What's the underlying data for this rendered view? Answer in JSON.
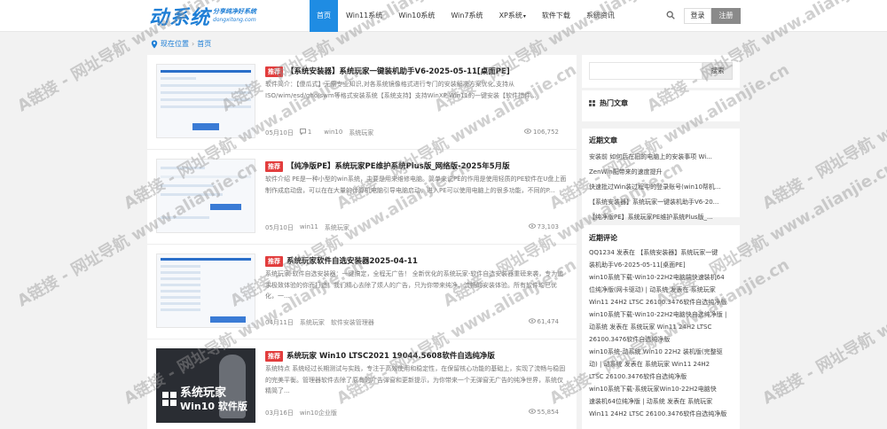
{
  "header": {
    "logo_main": "动系统",
    "logo_sub_cn": "分享纯净好系统",
    "logo_sub_en": "dongxitong.com",
    "nav": [
      "首页",
      "Win11系统",
      "Win10系统",
      "Win7系统",
      "XP系统",
      "软件下载",
      "系统资讯"
    ],
    "xp_caret": "▾",
    "login": "登录",
    "register": "注册"
  },
  "breadcrumb": {
    "label": "现在位置",
    "sep": "›",
    "home": "首页"
  },
  "posts": [
    {
      "tag": "推荐",
      "title": "【系统安装器】系统玩家一键装机助手V6-2025-05-11[桌面PE]",
      "desc": "软件简介：【傻瓜式】无需专业知识,对各系统镜像格式进行专门的安装解决方案优化,支持从ISO/wim/esd/gho/swm等格式安装系统【系统支持】支持WinXP-Win11的一键安装【软件措件...",
      "date": "05月10日",
      "comments": "1",
      "cats": [
        "win10",
        "系统玩家"
      ],
      "views": "106,752"
    },
    {
      "tag": "推荐",
      "title": "【纯净版PE】系统玩家PE维护系统Plus版_网络版-2025年5月版",
      "desc": "软件介绍 PE是一种小型的win系统，主要是用来维修电脑。简单来说PE的作用是使用轻质的PE软件在U盘上面制作成启动盘，可以在在大量的计算机电脑引导电脑启动，进入PE可以使用电脑上的很多功能，不同的P...",
      "date": "05月10日",
      "comments": "",
      "cats": [
        "win11",
        "系统玩家"
      ],
      "views": "73,103"
    },
    {
      "tag": "推荐",
      "title": "系统玩家软件自选安装器2025-04-11",
      "desc": "系统玩家-软件自选安装器：一键搞定，全程无广告！ 全新优化的系统玩家-软件自选安装器重磅来袭，专为追求极致体验的你而打造！我们精心去除了烦人的广告，只为你带来纯净、流畅的安装体验。所有软件均已优化，一...",
      "date": "04月11日",
      "comments": "",
      "cats": [
        "系统玩家",
        "软件安装管理器"
      ],
      "views": "61,474"
    },
    {
      "tag": "推荐",
      "title": "系统玩家 Win10 LTSC2021 19044.5608软件自选纯净版",
      "desc": "系统特点 系统经过长期测试与实践，专注于高效使用和稳定性，在保留核心功能的基础上，实现了流畅与稳固的完美平衡。管理器软件去除了原有的广告弹窗和更新提示，为你带来一个无弹窗无广告的纯净世界，系统仅精简了...",
      "date": "03月16日",
      "comments": "",
      "cats": [
        "win10企业版"
      ],
      "views": "55,854"
    }
  ],
  "thumb4": {
    "line1": "系统玩家",
    "line2": "Win10 软件版"
  },
  "sidebar": {
    "search_button": "搜索",
    "hot_title": "热门文章",
    "recent_title": "近期文章",
    "recent": [
      "安装前 如何后在旧的电脑上的安装事项 Wi...",
      "ZenWin配带来的速度提升",
      "快速批过Win装过程中的登录账号(win10帮机...",
      "【系统安装器】系统玩家一键装机助手V6-20...",
      "【纯净版PE】系统玩家PE维护系统Plus版_..."
    ],
    "comments_title": "近期评论",
    "comments": [
      "QQ1234 发表在 【系统安装器】系统玩家一键",
      "装机助手V6-2025-05-11[桌面PE]",
      "win10系统下载-Win10-22H2电脑端快速装机64",
      "位纯净版(网卡驱动) | 动系统 发表在 系统玩家",
      "Win11 24H2 LTSC 26100.3476软件自选纯净版",
      "win10系统下载-Win10-22H2电脑快自选纯净版 |",
      "动系统 发表在 系统玩家 Win11 24H2 LTSC",
      "26100.3476软件自选纯净版",
      "win10系统-动系统 Win10 22H2 装机版(完整驱",
      "动) | 动系统 发表在 系统玩家 Win11 24H2",
      "LTSC 26100.3476软件自选纯净版",
      "win10系统下载-系统玩家Win10-22H2电脑快",
      "速装机64位纯净版 | 动系统 发表在 系统玩家",
      "Win11 24H2 LTSC 26100.3476软件自选纯净版"
    ]
  },
  "watermark": "A链接 - 网址导航 www.alianjie.cn"
}
